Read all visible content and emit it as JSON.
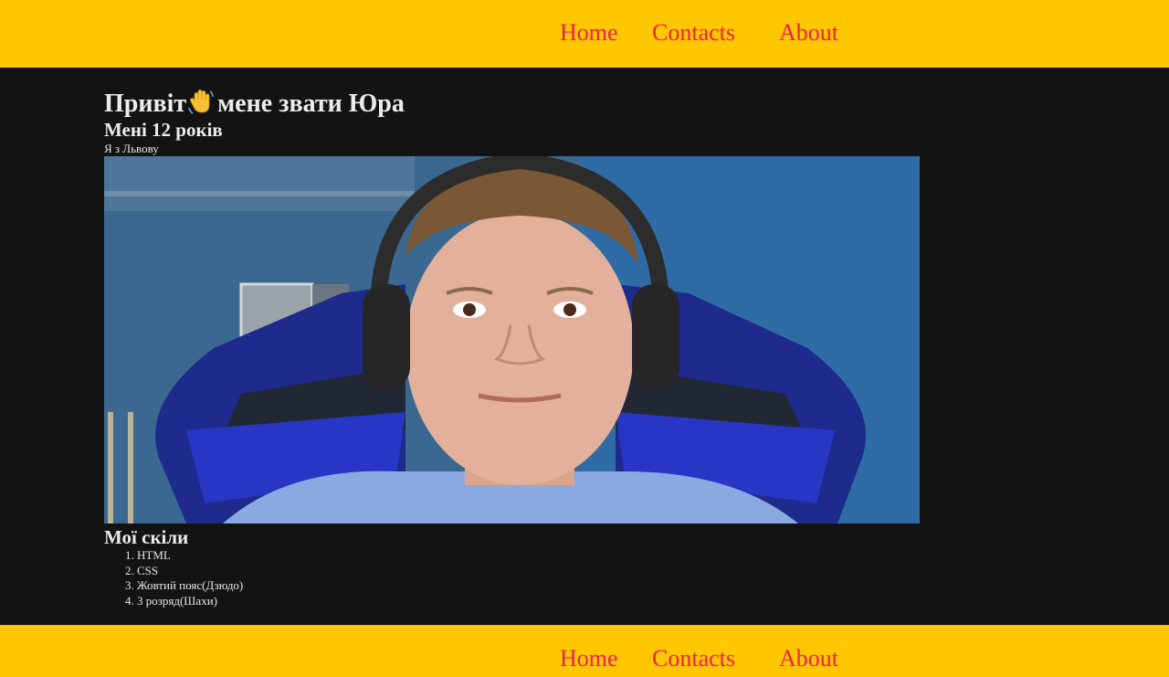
{
  "nav": {
    "home": "Home",
    "contacts": "Contacts",
    "about": "About"
  },
  "hero": {
    "greeting_start": "Привіт",
    "greeting_icon": "waving-hand-icon",
    "greeting_end": "мене звати Юра",
    "age": "Мені 12 років",
    "from": "Я з Львову"
  },
  "photo": {
    "subject": "boy-with-headphones-in-gaming-chair"
  },
  "skills": {
    "title": "Мої скіли",
    "items": [
      "HTML",
      "CSS",
      "Жовтий пояс(Дзюдо)",
      "3 розряд(Шахи)"
    ]
  },
  "colors": {
    "bar": "#ffc700",
    "nav_link": "#ee1f55",
    "background": "#131313"
  }
}
